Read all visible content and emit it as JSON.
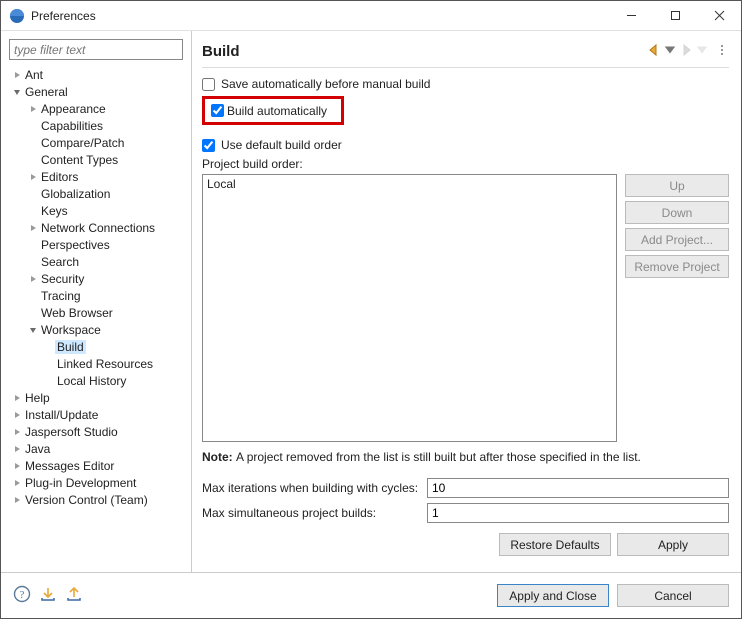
{
  "window": {
    "title": "Preferences"
  },
  "sidebar": {
    "filter_placeholder": "type filter text",
    "items": [
      {
        "label": "Ant",
        "depth": 0,
        "exp": "closed"
      },
      {
        "label": "General",
        "depth": 0,
        "exp": "open"
      },
      {
        "label": "Appearance",
        "depth": 1,
        "exp": "closed"
      },
      {
        "label": "Capabilities",
        "depth": 1,
        "exp": "none"
      },
      {
        "label": "Compare/Patch",
        "depth": 1,
        "exp": "none"
      },
      {
        "label": "Content Types",
        "depth": 1,
        "exp": "none"
      },
      {
        "label": "Editors",
        "depth": 1,
        "exp": "closed"
      },
      {
        "label": "Globalization",
        "depth": 1,
        "exp": "none"
      },
      {
        "label": "Keys",
        "depth": 1,
        "exp": "none"
      },
      {
        "label": "Network Connections",
        "depth": 1,
        "exp": "closed"
      },
      {
        "label": "Perspectives",
        "depth": 1,
        "exp": "none"
      },
      {
        "label": "Search",
        "depth": 1,
        "exp": "none"
      },
      {
        "label": "Security",
        "depth": 1,
        "exp": "closed"
      },
      {
        "label": "Tracing",
        "depth": 1,
        "exp": "none"
      },
      {
        "label": "Web Browser",
        "depth": 1,
        "exp": "none"
      },
      {
        "label": "Workspace",
        "depth": 1,
        "exp": "open"
      },
      {
        "label": "Build",
        "depth": 2,
        "exp": "none",
        "selected": true
      },
      {
        "label": "Linked Resources",
        "depth": 2,
        "exp": "none"
      },
      {
        "label": "Local History",
        "depth": 2,
        "exp": "none"
      },
      {
        "label": "Help",
        "depth": 0,
        "exp": "closed"
      },
      {
        "label": "Install/Update",
        "depth": 0,
        "exp": "closed"
      },
      {
        "label": "Jaspersoft Studio",
        "depth": 0,
        "exp": "closed"
      },
      {
        "label": "Java",
        "depth": 0,
        "exp": "closed"
      },
      {
        "label": "Messages Editor",
        "depth": 0,
        "exp": "closed"
      },
      {
        "label": "Plug-in Development",
        "depth": 0,
        "exp": "closed"
      },
      {
        "label": "Version Control (Team)",
        "depth": 0,
        "exp": "closed"
      }
    ]
  },
  "page": {
    "heading": "Build",
    "save_before_label": "Save automatically before manual build",
    "save_before_checked": false,
    "build_auto_label": "Build automatically",
    "build_auto_checked": true,
    "use_default_label": "Use default build order",
    "use_default_checked": true,
    "project_order_label": "Project build order:",
    "project_order_items": [
      "Local"
    ],
    "buttons": {
      "up": "Up",
      "down": "Down",
      "add": "Add Project...",
      "remove": "Remove Project"
    },
    "note_bold": "Note:",
    "note_text": "A project removed from the list is still built but after those specified in the list.",
    "max_iter_label": "Max iterations when building with cycles:",
    "max_iter_value": "10",
    "max_sim_label": "Max simultaneous project builds:",
    "max_sim_value": "1",
    "restore_label": "Restore Defaults",
    "apply_label": "Apply"
  },
  "footer": {
    "apply_close": "Apply and Close",
    "cancel": "Cancel"
  }
}
